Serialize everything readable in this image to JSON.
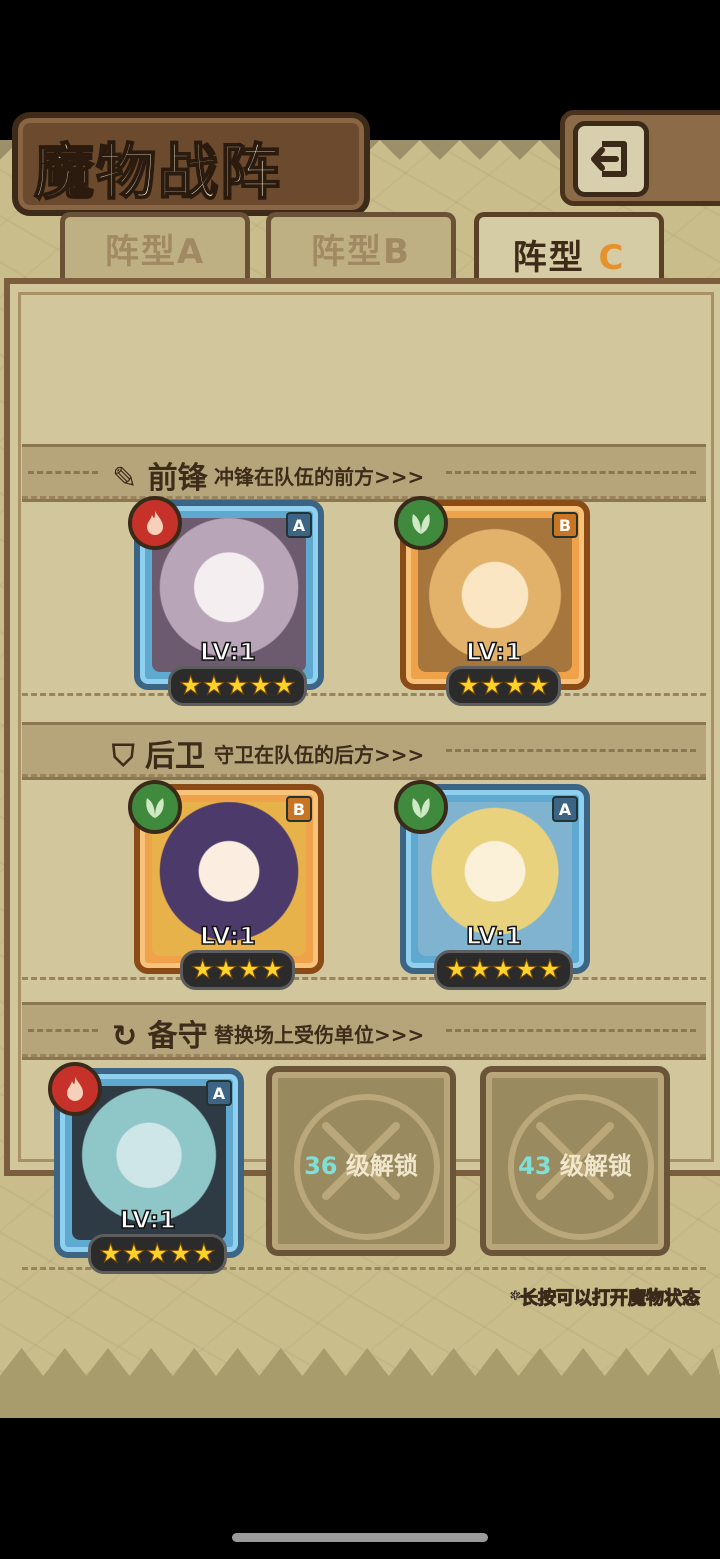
{
  "title": "魔物战阵",
  "tabs": [
    {
      "label": "阵型",
      "letter": "A",
      "active": false
    },
    {
      "label": "阵型",
      "letter": "B",
      "active": false
    },
    {
      "label": "阵型",
      "letter": "C",
      "active": true
    }
  ],
  "sections": {
    "front": {
      "title": "前锋",
      "subtitle": "冲锋在队伍的前方>>>"
    },
    "back": {
      "title": "后卫",
      "subtitle": "守卫在队伍的后方>>>"
    },
    "reserve": {
      "title": "备守",
      "subtitle": "替换场上受伤单位>>>"
    }
  },
  "monsters": [
    {
      "slot": "front-1",
      "grade": "A",
      "frame": "blue",
      "element": "fire",
      "level": "LV:1",
      "stars": 5
    },
    {
      "slot": "front-2",
      "grade": "B",
      "frame": "orange",
      "element": "grass",
      "level": "LV:1",
      "stars": 4
    },
    {
      "slot": "back-1",
      "grade": "B",
      "frame": "orange",
      "element": "grass",
      "level": "LV:1",
      "stars": 4
    },
    {
      "slot": "back-2",
      "grade": "A",
      "frame": "blue",
      "element": "grass",
      "level": "LV:1",
      "stars": 5
    },
    {
      "slot": "reserve-1",
      "grade": "A",
      "frame": "blue",
      "element": "fire",
      "level": "LV:1",
      "stars": 5
    }
  ],
  "locked_slots": [
    {
      "level": "36",
      "text": "级解锁"
    },
    {
      "level": "43",
      "text": "级解锁"
    }
  ],
  "hint": "*长按可以打开魔物状态",
  "stars_5": "★★★★★",
  "stars_4": "★★★★",
  "colors": {
    "fire": "#c6322a",
    "grass": "#3f8a3d",
    "grade_a": "#3c6585",
    "grade_b": "#c97624"
  }
}
